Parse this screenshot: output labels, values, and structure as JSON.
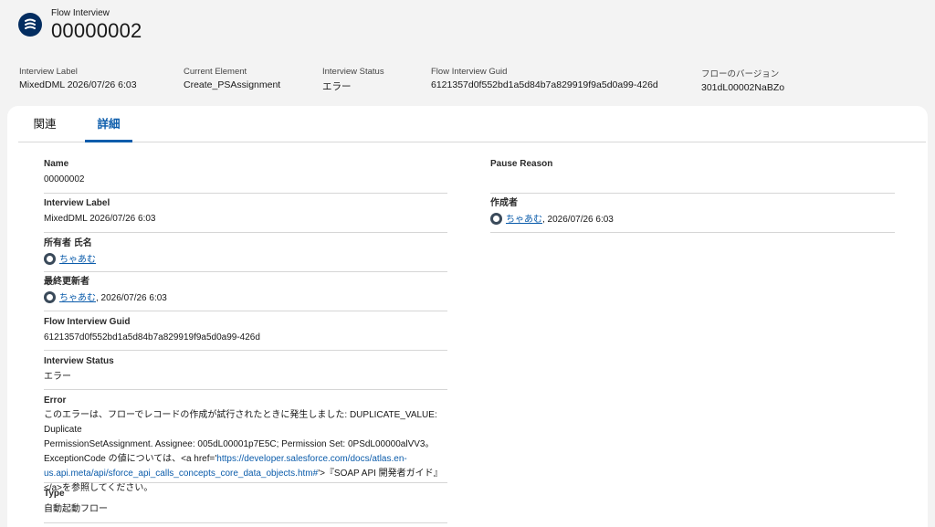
{
  "header": {
    "object_type": "Flow Interview",
    "record_name": "00000002",
    "fields": [
      {
        "label": "Interview Label",
        "value": "MixedDML 2026/07/26 6:03"
      },
      {
        "label": "Current Element",
        "value": "Create_PSAssignment"
      },
      {
        "label": "Interview Status",
        "value": "エラー"
      },
      {
        "label": "Flow Interview Guid",
        "value": "6121357d0f552bd1a5d84b7a829919f9a5d0a99-426d"
      },
      {
        "label": "フローのバージョン",
        "value": "301dL00002NaBZo"
      }
    ]
  },
  "tabs": [
    {
      "label": "関連"
    },
    {
      "label": "詳細"
    }
  ],
  "details": {
    "name": {
      "label": "Name",
      "value": "00000002"
    },
    "interview_label": {
      "label": "Interview Label",
      "value": "MixedDML 2026/07/26 6:03"
    },
    "owner": {
      "label": "所有者 氏名",
      "user": "ちゃあむ"
    },
    "last_modified": {
      "label": "最終更新者",
      "user": "ちゃあむ",
      "date": ", 2026/07/26 6:03"
    },
    "guid": {
      "label": "Flow Interview Guid",
      "value": "6121357d0f552bd1a5d84b7a829919f9a5d0a99-426d"
    },
    "status": {
      "label": "Interview Status",
      "value": "エラー"
    },
    "error": {
      "label": "Error",
      "line1": "このエラーは、フローでレコードの作成が試行されたときに発生しました: DUPLICATE_VALUE: Duplicate",
      "line2": "PermissionSetAssignment. Assignee: 005dL00001p7E5C; Permission Set: 0PSdL00000alVV3。",
      "line3_prefix": "ExceptionCode の値については、<a href='",
      "line3_link": "https://developer.salesforce.com/docs/atlas.en-",
      "line4_link": "us.api.meta/api/sforce_api_calls_concepts_core_data_objects.htm#",
      "line4_suffix": "'>『SOAP API 開発者ガイド』",
      "line5": "</a>を参照してください。"
    },
    "type": {
      "label": "Type",
      "value": "自動起動フロー"
    },
    "pause_reason": {
      "label": "Pause Reason",
      "value": ""
    },
    "created_by": {
      "label": "作成者",
      "user": "ちゃあむ",
      "date": ", 2026/07/26 6:03"
    }
  }
}
